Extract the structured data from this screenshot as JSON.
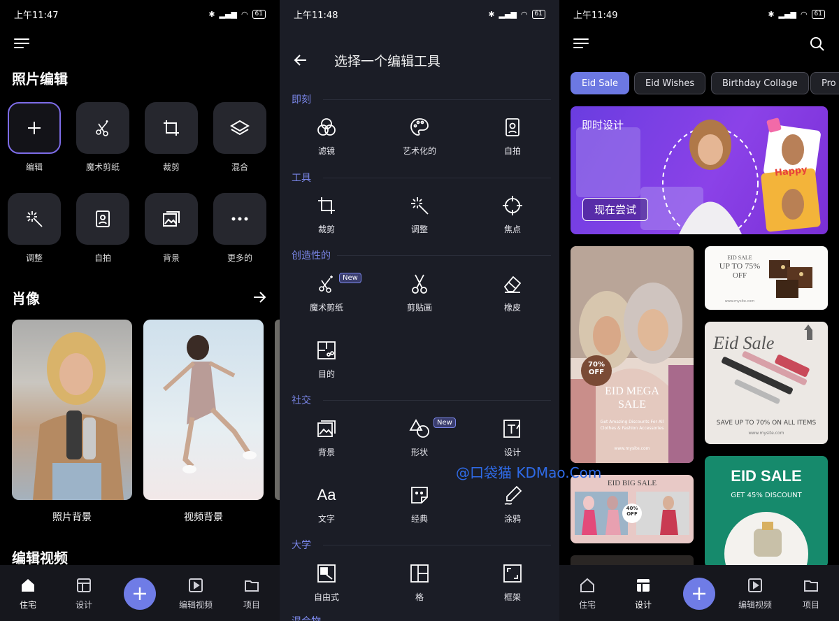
{
  "status_bar": [
    {
      "time": "上午11:47",
      "battery": "61"
    },
    {
      "time": "上午11:48",
      "battery": "61"
    },
    {
      "time": "上午11:49",
      "battery": "61"
    }
  ],
  "home": {
    "section_photo_edit": "照片编辑",
    "tools": [
      {
        "label": "编辑",
        "icon": "plus-icon"
      },
      {
        "label": "魔术剪纸",
        "icon": "magic-scissors-icon"
      },
      {
        "label": "裁剪",
        "icon": "crop-icon"
      },
      {
        "label": "混合",
        "icon": "layers-icon"
      },
      {
        "label": "调整",
        "icon": "magic-wand-icon"
      },
      {
        "label": "自拍",
        "icon": "portrait-icon"
      },
      {
        "label": "背景",
        "icon": "image-icon"
      },
      {
        "label": "更多的",
        "icon": "more-icon"
      }
    ],
    "section_portrait": "肖像",
    "portrait_cards": [
      {
        "label": "照片背景"
      },
      {
        "label": "视频背景"
      }
    ],
    "section_edit_video": "编辑视频"
  },
  "editor": {
    "title": "选择一个编辑工具",
    "categories": [
      {
        "name": "即刻",
        "tools": [
          "滤镜",
          "艺术化的",
          "自拍"
        ]
      },
      {
        "name": "工具",
        "tools": [
          "裁剪",
          "调整",
          "焦点"
        ]
      },
      {
        "name": "创造性的",
        "tools": [
          "魔术剪纸",
          "剪贴画",
          "橡皮",
          "目的"
        ]
      },
      {
        "name": "社交",
        "tools": [
          "背景",
          "形状",
          "设计",
          "文字",
          "经典",
          "涂鸦"
        ]
      },
      {
        "name": "大学",
        "tools": [
          "自由式",
          "格",
          "框架"
        ]
      },
      {
        "name": "混合物"
      }
    ],
    "new_badge": "New"
  },
  "design": {
    "chips": [
      "Eid Sale",
      "Eid Wishes",
      "Birthday Collage",
      "Pro"
    ],
    "banner": {
      "title": "即时设计",
      "button": "现在尝试",
      "happy": "Happy"
    },
    "templates": {
      "eid_mega": {
        "badge_pct": "70%",
        "badge_off": "OFF",
        "title1": "EID MEGA",
        "title2": "SALE",
        "sub": "Get Amazing Discounts For All Clothes & Fashion Accessories",
        "site": "www.mysite.com"
      },
      "eid_sale_small": {
        "line1": "EID SALE",
        "line2": "UP TO 75%",
        "line3": "OFF",
        "site": "www.mysite.com"
      },
      "eid_sale_cosmetic": {
        "title": "Eid Sale",
        "sub": "SAVE UP TO 70% ON ALL ITEMS",
        "site": "www.mysite.com"
      },
      "eid_big_sale": {
        "title": "EID BIG SALE",
        "badge_pct": "40%",
        "badge_off": "OFF"
      },
      "eid_sale_green": {
        "title": "EID SALE",
        "sub": "GET 45% DISCOUNT"
      }
    }
  },
  "nav": {
    "home_tabs": [
      "住宅",
      "设计",
      "编辑视频",
      "项目"
    ],
    "design_tabs": [
      "住宅",
      "设计",
      "编辑视频",
      "项目"
    ]
  },
  "watermark": "@口袋猫 KDMao.Com",
  "colors": {
    "accent": "#6f7ce6",
    "category": "#7a86e8",
    "panel_bg": "#1b1d26"
  }
}
